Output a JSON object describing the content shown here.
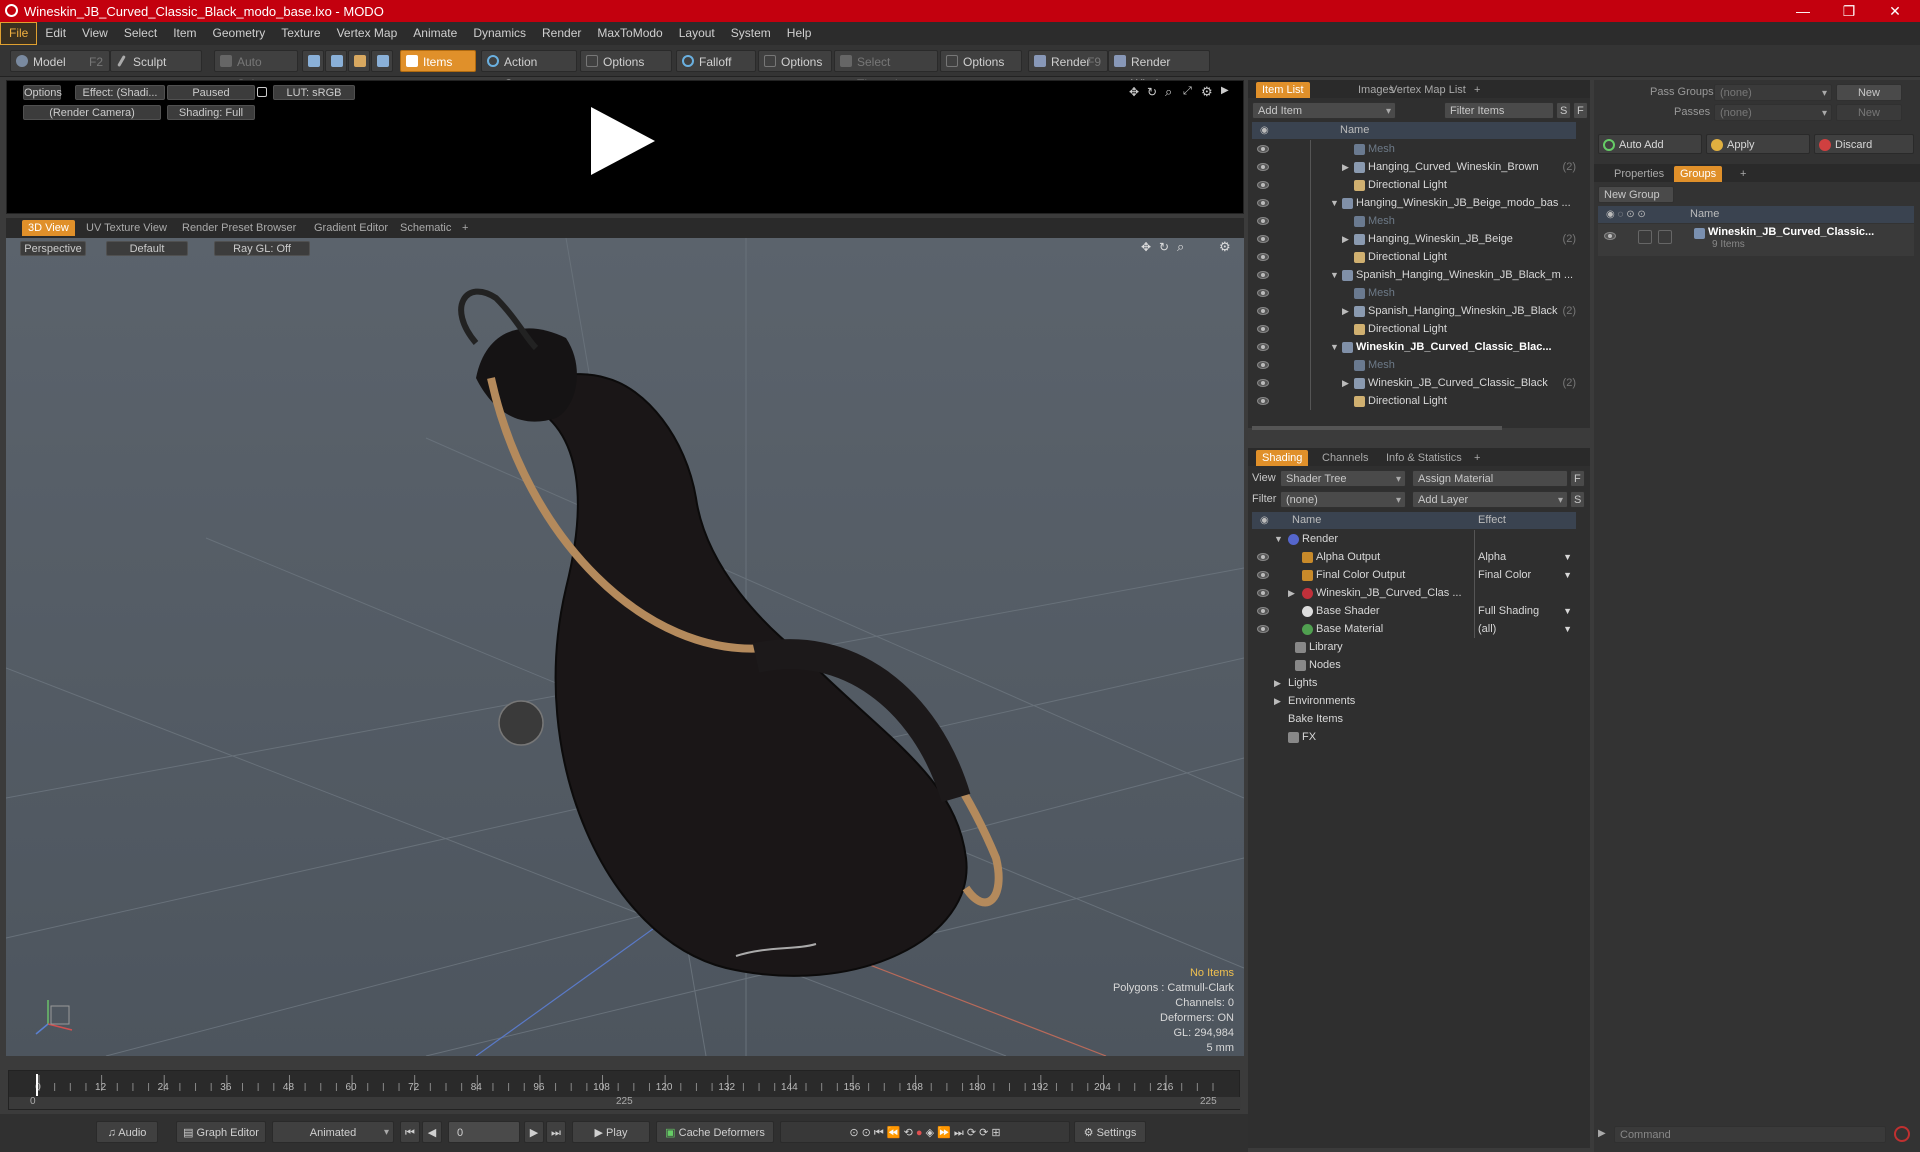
{
  "window": {
    "title": "Wineskin_JB_Curved_Classic_Black_modo_base.lxo - MODO",
    "minimize": "—",
    "maximize": "❐",
    "close": "✕"
  },
  "menu": [
    "File",
    "Edit",
    "View",
    "Select",
    "Item",
    "Geometry",
    "Texture",
    "Vertex Map",
    "Animate",
    "Dynamics",
    "Render",
    "MaxToModo",
    "Layout",
    "System",
    "Help"
  ],
  "toolbar": {
    "model": "Model",
    "model_key": "F2",
    "sculpt": "Sculpt",
    "auto_select": "Auto Select",
    "items": "Items",
    "action_center": "Action Center",
    "options1": "Options",
    "falloff": "Falloff",
    "options2": "Options",
    "select_through": "Select Through",
    "options3": "Options",
    "render": "Render",
    "render_key": "F9",
    "render_window": "Render Window"
  },
  "preview": {
    "options": "Options",
    "effect": "Effect: (Shadi...",
    "paused": "Paused",
    "lut": "LUT: sRGB",
    "camera": "(Render Camera)",
    "shading": "Shading: Full",
    "play": "▶"
  },
  "viewport_tabs": [
    "3D View",
    "UV Texture View",
    "Render Preset Browser",
    "Gradient Editor",
    "Schematic",
    "+"
  ],
  "viewport": {
    "perspective": "Perspective",
    "default": "Default",
    "raygl": "Ray GL: Off"
  },
  "stats": {
    "no_items": "No Items",
    "polygons": "Polygons : Catmull-Clark",
    "channels": "Channels: 0",
    "deformers": "Deformers: ON",
    "gl": "GL: 294,984",
    "unit": "5 mm"
  },
  "timeline": {
    "ticks": [
      "0",
      "12",
      "24",
      "36",
      "48",
      "60",
      "72",
      "84",
      "96",
      "108",
      "120",
      "132",
      "144",
      "156",
      "168",
      "180",
      "192",
      "204",
      "216"
    ],
    "start": "0",
    "mid": "225",
    "end": "225"
  },
  "bottombar": {
    "audio": "Audio",
    "graph_editor": "Graph Editor",
    "animated": "Animated",
    "frame": "0",
    "play": "Play",
    "cache": "Cache Deformers",
    "settings": "Settings"
  },
  "itemlist": {
    "tabs": [
      "Item List",
      "Images",
      "Vertex Map List",
      "+"
    ],
    "add_item": "Add Item",
    "filter": "Filter Items",
    "s": "S",
    "f": "F",
    "col_name": "Name",
    "rows": [
      {
        "label": "Mesh",
        "indent": 2,
        "dim": true,
        "tri": "",
        "count": ""
      },
      {
        "label": "Hanging_Curved_Wineskin_Brown",
        "indent": 2,
        "tri": "▶",
        "count": "(2)"
      },
      {
        "label": "Directional Light",
        "indent": 2,
        "tri": "",
        "count": ""
      },
      {
        "label": "Hanging_Wineskin_JB_Beige_modo_bas ...",
        "indent": 1,
        "tri": "▼",
        "count": ""
      },
      {
        "label": "Mesh",
        "indent": 2,
        "dim": true,
        "tri": "",
        "count": ""
      },
      {
        "label": "Hanging_Wineskin_JB_Beige",
        "indent": 2,
        "tri": "▶",
        "count": "(2)"
      },
      {
        "label": "Directional Light",
        "indent": 2,
        "tri": "",
        "count": ""
      },
      {
        "label": "Spanish_Hanging_Wineskin_JB_Black_m ...",
        "indent": 1,
        "tri": "▼",
        "count": ""
      },
      {
        "label": "Mesh",
        "indent": 2,
        "dim": true,
        "tri": "",
        "count": ""
      },
      {
        "label": "Spanish_Hanging_Wineskin_JB_Black",
        "indent": 2,
        "tri": "▶",
        "count": "(2)"
      },
      {
        "label": "Directional Light",
        "indent": 2,
        "tri": "",
        "count": ""
      },
      {
        "label": "Wineskin_JB_Curved_Classic_Blac...",
        "indent": 1,
        "tri": "▼",
        "bold": true,
        "count": ""
      },
      {
        "label": "Mesh",
        "indent": 2,
        "dim": true,
        "tri": "",
        "count": ""
      },
      {
        "label": "Wineskin_JB_Curved_Classic_Black",
        "indent": 2,
        "tri": "▶",
        "count": "(2)"
      },
      {
        "label": "Directional Light",
        "indent": 2,
        "tri": "",
        "count": ""
      }
    ]
  },
  "shading": {
    "tabs": [
      "Shading",
      "Channels",
      "Info & Statistics",
      "+"
    ],
    "view_label": "View",
    "view_value": "Shader Tree",
    "assign": "Assign Material",
    "f": "F",
    "filter_label": "Filter",
    "filter_value": "(none)",
    "add_layer": "Add Layer",
    "s": "S",
    "col_name": "Name",
    "col_effect": "Effect",
    "rows": [
      {
        "label": "Render",
        "effect": "",
        "indent": 0,
        "tri": "▼",
        "eye": false,
        "color": "#5566cc",
        "round": true
      },
      {
        "label": "Alpha Output",
        "effect": "Alpha",
        "indent": 1,
        "tri": "",
        "eye": true,
        "color": "#c88a2a"
      },
      {
        "label": "Final Color Output",
        "effect": "Final Color",
        "indent": 1,
        "tri": "",
        "eye": true,
        "color": "#c88a2a"
      },
      {
        "label": "Wineskin_JB_Curved_Clas ...",
        "effect": "",
        "indent": 1,
        "tri": "▶",
        "eye": true,
        "color": "#c0303a",
        "round": true
      },
      {
        "label": "Base Shader",
        "effect": "Full Shading",
        "indent": 1,
        "tri": "",
        "eye": true,
        "color": "#dddddd",
        "round": true
      },
      {
        "label": "Base Material",
        "effect": "(all)",
        "indent": 1,
        "tri": "",
        "eye": true,
        "color": "#50a050",
        "round": true
      },
      {
        "label": "Library",
        "effect": "",
        "indent": 0.5,
        "tri": "",
        "eye": false,
        "color": "#888888"
      },
      {
        "label": "Nodes",
        "effect": "",
        "indent": 0.5,
        "tri": "",
        "eye": false,
        "color": "#888888"
      },
      {
        "label": "Lights",
        "effect": "",
        "indent": 0,
        "tri": "▶",
        "eye": false,
        "color": ""
      },
      {
        "label": "Environments",
        "effect": "",
        "indent": 0,
        "tri": "▶",
        "eye": false,
        "color": ""
      },
      {
        "label": "Bake Items",
        "effect": "",
        "indent": 0,
        "tri": "",
        "eye": false,
        "color": ""
      },
      {
        "label": "FX",
        "effect": "",
        "indent": 0,
        "tri": "",
        "eye": false,
        "color": "#888888"
      }
    ]
  },
  "groups": {
    "pass_groups": "Pass Groups",
    "pass_value": "(none)",
    "new": "New",
    "passes": "Passes",
    "passes_value": "(none)",
    "new2": "New",
    "auto_add": "Auto Add",
    "apply": "Apply",
    "discard": "Discard",
    "tabs": [
      "Properties",
      "Groups",
      "+"
    ],
    "new_group": "New Group",
    "col_name": "Name",
    "group_name": "Wineskin_JB_Curved_Classic...",
    "group_count": "9 Items"
  },
  "command": {
    "placeholder": "Command"
  }
}
